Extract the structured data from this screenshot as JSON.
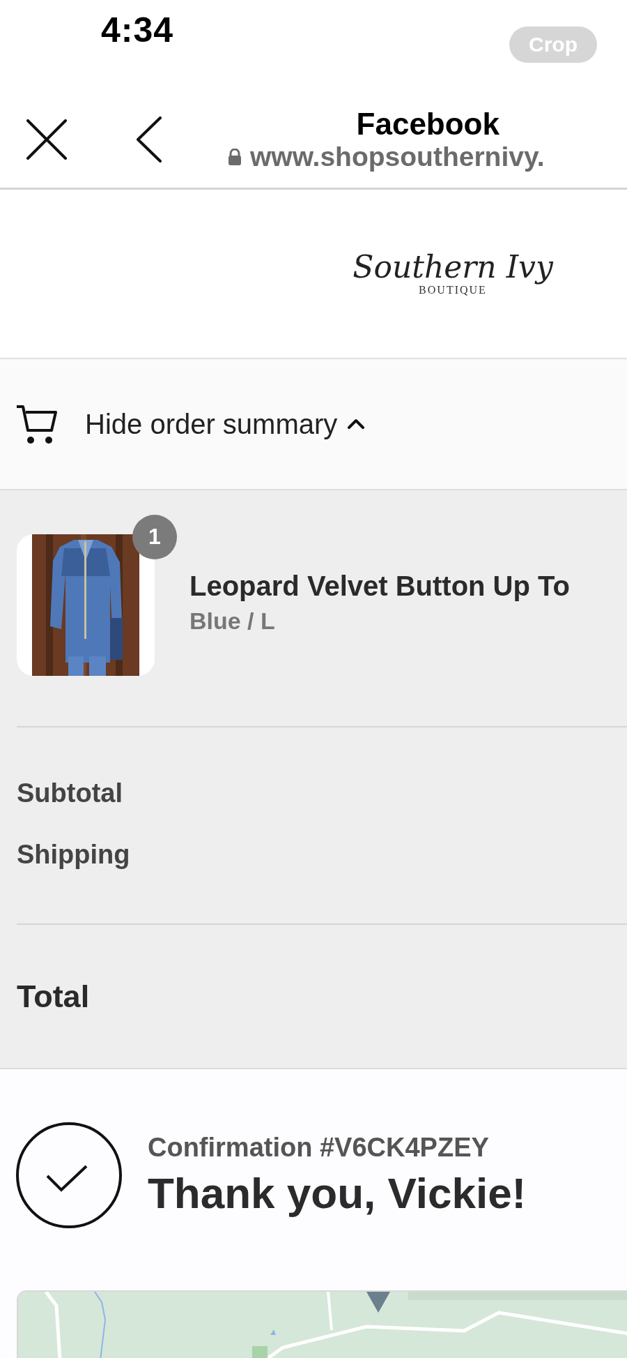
{
  "status_bar": {
    "time": "4:34",
    "crop_button": "Crop"
  },
  "browser": {
    "title": "Facebook",
    "url": "www.shopsouthernivy."
  },
  "logo": {
    "script": "Southern Ivy",
    "subtitle": "BOUTIQUE"
  },
  "order_summary": {
    "toggle": "Hide order summary",
    "expanded": true,
    "items": [
      {
        "name": "Leopard Velvet Button Up To",
        "variant": "Blue / L",
        "quantity": "1"
      }
    ],
    "rows": [
      {
        "label": "Subtotal"
      },
      {
        "label": "Shipping"
      }
    ],
    "total": {
      "label": "Total"
    }
  },
  "confirmation": {
    "number": "Confirmation #V6CK4PZEY",
    "heading": "Thank you, Vickie!"
  }
}
